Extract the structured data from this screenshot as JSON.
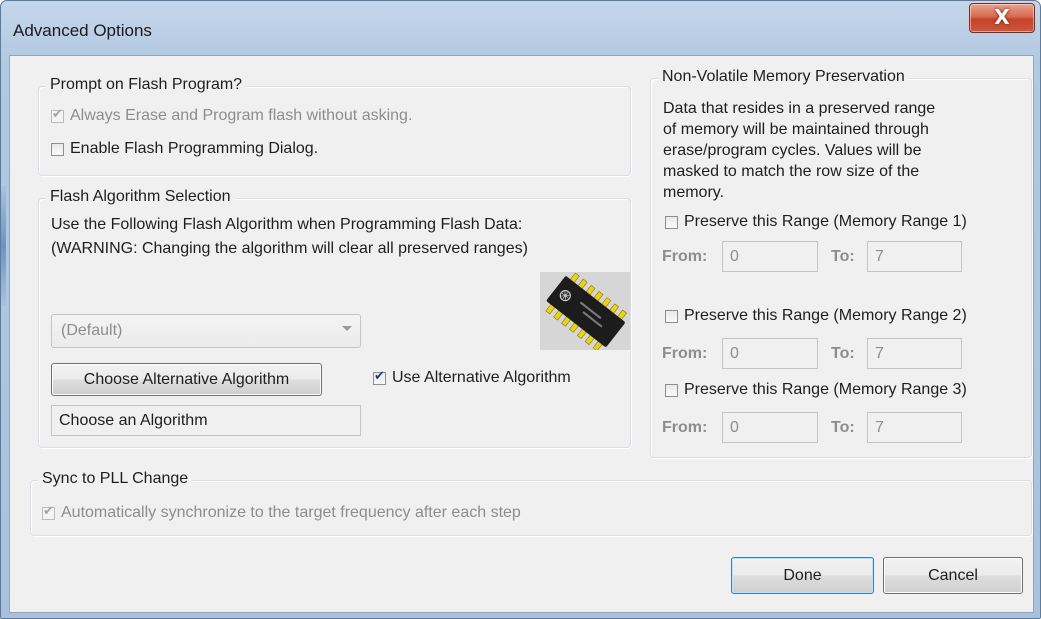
{
  "window": {
    "title": "Advanced Options",
    "close_label": "X"
  },
  "prompt_group": {
    "legend": "Prompt on Flash Program?",
    "always_erase_label": "Always Erase and Program flash without asking.",
    "always_erase_checked": true,
    "always_erase_enabled": false,
    "enable_dialog_label": "Enable Flash Programming Dialog.",
    "enable_dialog_checked": false
  },
  "algorithm_group": {
    "legend": "Flash Algorithm Selection",
    "line1": "Use the Following Flash Algorithm when Programming Flash Data:",
    "line2": "(WARNING: Changing the algorithm will clear all preserved ranges)",
    "dropdown_value": "(Default)",
    "choose_button_label": "Choose Alternative Algorithm",
    "use_alt_label": "Use Alternative Algorithm",
    "use_alt_checked": true,
    "algorithm_field_value": "Choose an Algorithm",
    "icon": "ic-chip-icon"
  },
  "nvm_group": {
    "legend": "Non-Volatile Memory Preservation",
    "description_lines": [
      "Data that resides in a preserved range",
      "of memory will be maintained through",
      "erase/program cycles. Values will be",
      "masked to match the row size of the",
      "memory."
    ],
    "ranges": [
      {
        "label": "Preserve this Range (Memory Range 1)",
        "checked": false,
        "from_label": "From:",
        "from_value": "0",
        "to_label": "To:",
        "to_value": "7"
      },
      {
        "label": "Preserve this Range (Memory Range 2)",
        "checked": false,
        "from_label": "From:",
        "from_value": "0",
        "to_label": "To:",
        "to_value": "7"
      },
      {
        "label": "Preserve this Range (Memory Range 3)",
        "checked": false,
        "from_label": "From:",
        "from_value": "0",
        "to_label": "To:",
        "to_value": "7"
      }
    ]
  },
  "sync_group": {
    "legend": "Sync to PLL Change",
    "auto_sync_label": "Automatically synchronize to the target frequency after each step",
    "auto_sync_checked": true,
    "auto_sync_enabled": false
  },
  "footer": {
    "done_label": "Done",
    "cancel_label": "Cancel"
  },
  "colors": {
    "titlebar": "#b3c9e2",
    "close_button": "#c2432a",
    "dialog_bg": "#f0f0f0",
    "chip_pins": "#e8d21a"
  }
}
